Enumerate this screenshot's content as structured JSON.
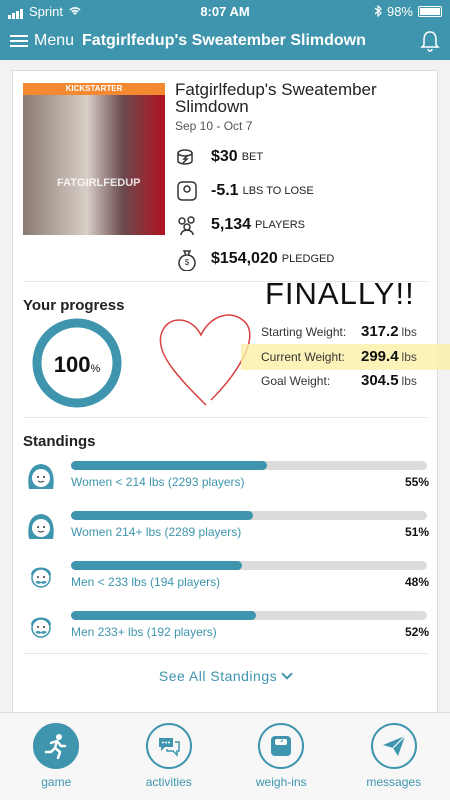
{
  "status_bar": {
    "carrier": "Sprint",
    "time": "8:07 AM",
    "battery": "98%"
  },
  "nav": {
    "menu_label": "Menu",
    "title": "Fatgirlfedup's Sweatember Slimdown"
  },
  "game": {
    "image_badge": "KICKSTARTER",
    "image_watermark": "FATGIRLFEDUP",
    "title": "Fatgirlfedup's Sweatember Slimdown",
    "dates": "Sep 10 - Oct 7",
    "bet": {
      "value": "$30",
      "unit": "BET",
      "icon": "coins-icon"
    },
    "to_lose": {
      "value": "-5.1",
      "unit": "LBS TO LOSE",
      "icon": "scale-icon"
    },
    "players": {
      "value": "5,134",
      "unit": "PLAYERS",
      "icon": "players-icon"
    },
    "pledged": {
      "value": "$154,020",
      "unit": "PLEDGED",
      "icon": "money-bag-icon"
    }
  },
  "progress": {
    "title": "Your progress",
    "percent_value": 100,
    "percent_number": "100",
    "percent_sign": "%",
    "annotation": "FINALLY!!",
    "starting_label": "Starting Weight:",
    "starting_value": "317.2",
    "starting_unit": "lbs",
    "current_label": "Current Weight:",
    "current_value": "299.4",
    "current_unit": "lbs",
    "goal_label": "Goal Weight:",
    "goal_value": "304.5",
    "goal_unit": "lbs"
  },
  "standings": {
    "title": "Standings",
    "items": [
      {
        "label": "Women < 214 lbs (2293 players)",
        "percent": "55%",
        "fill": 0.55,
        "avatar": "woman-avatar-icon"
      },
      {
        "label": "Women 214+ lbs (2289 players)",
        "percent": "51%",
        "fill": 0.51,
        "avatar": "woman-avatar-icon"
      },
      {
        "label": "Men < 233 lbs (194 players)",
        "percent": "48%",
        "fill": 0.48,
        "avatar": "man-avatar-icon"
      },
      {
        "label": "Men 233+ lbs (192 players)",
        "percent": "52%",
        "fill": 0.52,
        "avatar": "man-avatar-icon"
      }
    ],
    "see_all": "See All Standings"
  },
  "tabs": [
    {
      "label": "game",
      "icon": "runner-icon",
      "active": true
    },
    {
      "label": "activities",
      "icon": "chat-bubbles-icon",
      "active": false
    },
    {
      "label": "weigh-ins",
      "icon": "scale-icon",
      "active": false
    },
    {
      "label": "messages",
      "icon": "paper-plane-icon",
      "active": false
    }
  ],
  "colors": {
    "brand": "#3e95ad",
    "highlight": "#fbf0a8",
    "annotation": "#d94040"
  }
}
